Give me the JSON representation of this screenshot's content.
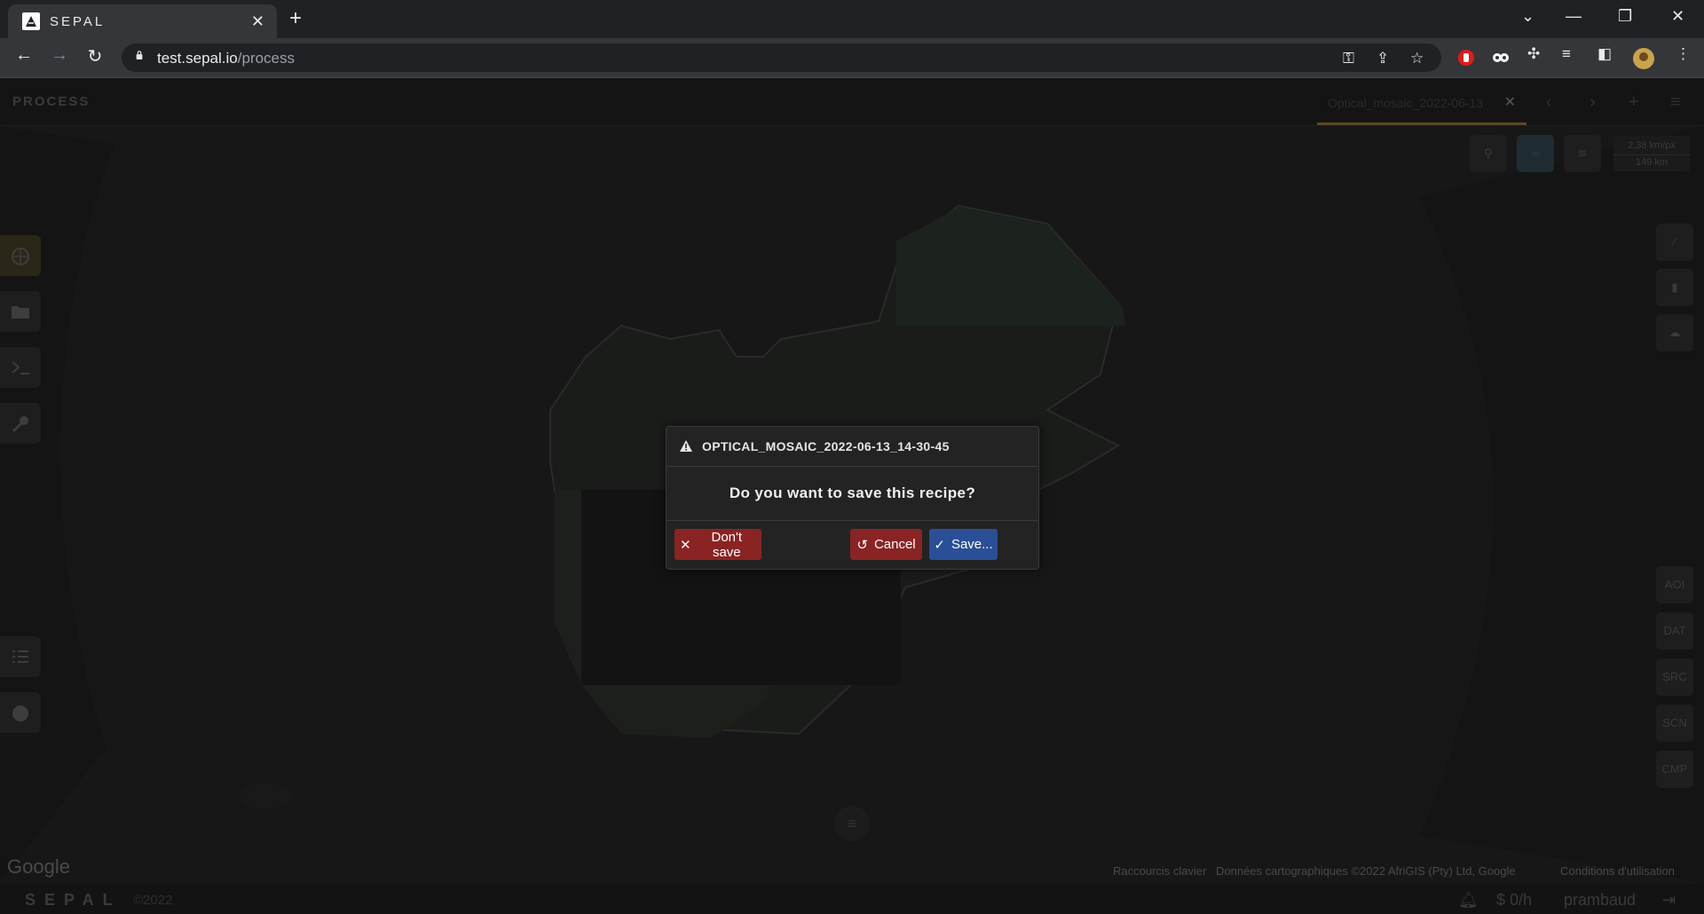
{
  "browser": {
    "tab_title": "SEPAL",
    "tab_close": "✕",
    "new_tab": "+",
    "url_host": "test.sepal.io",
    "url_path": "/process"
  },
  "app": {
    "section_title": "PROCESS",
    "recipe_tab_label": "Optical_mosaic_2022-06-13",
    "recipe_tab_close": "✕"
  },
  "map": {
    "scale_top": "2,38 km/px",
    "scale_bottom": "149 km",
    "google": "Google",
    "attrib_shortcuts": "Raccourcis clavier",
    "attrib_data": "Données cartographiques ©2022 AfriGIS (Pty) Ltd, Google",
    "attrib_terms": "Conditions d'utilisation",
    "right_panels": [
      "AOI",
      "DAT",
      "SRC",
      "SCN",
      "CMP"
    ]
  },
  "footer": {
    "logo": "SEPAL",
    "copyright": "©2022",
    "budget": "$ 0/h",
    "user": "prambaud"
  },
  "dialog": {
    "title": "OPTICAL_MOSAIC_2022-06-13_14-30-45",
    "question": "Do you want to save this recipe?",
    "dont_save": "Don't save",
    "cancel": "Cancel",
    "save": "Save..."
  },
  "colors": {
    "danger": "#8a2323",
    "primary": "#2a4f97",
    "accent_tab": "#5a4a22"
  }
}
